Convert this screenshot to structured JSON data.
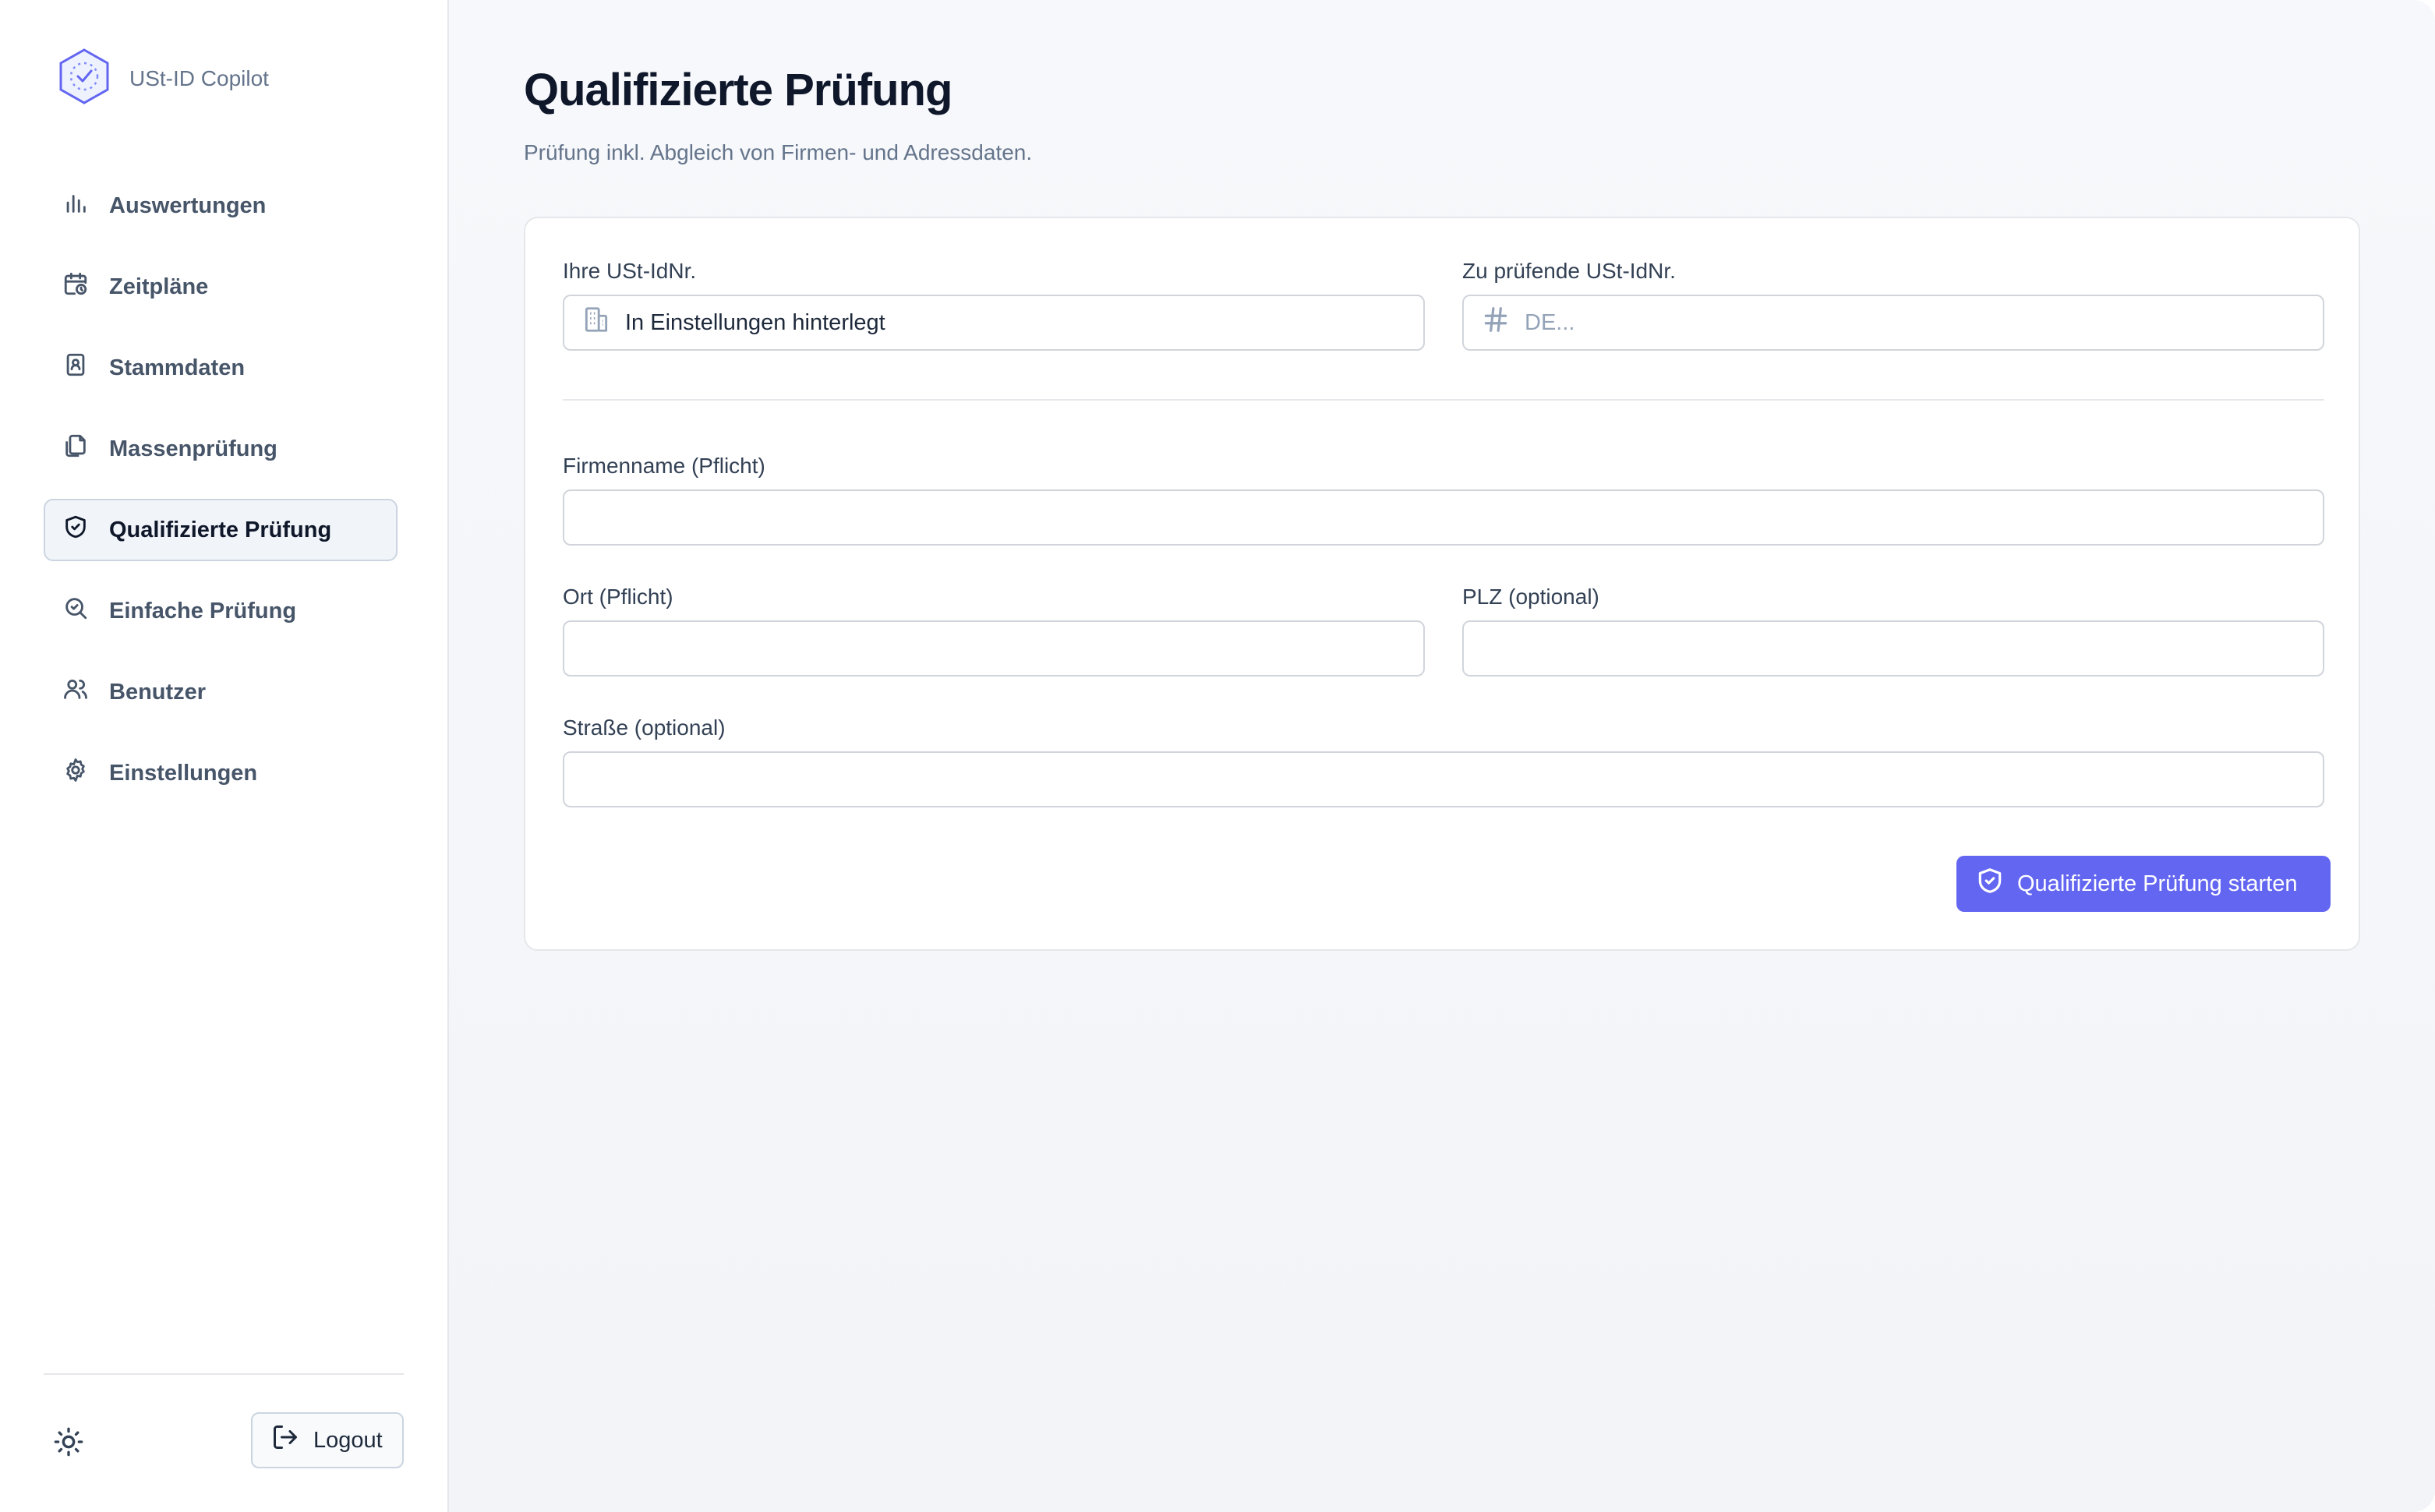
{
  "brand": {
    "name": "USt-ID Copilot",
    "icon": "hexagon-check-logo"
  },
  "nav": {
    "items": [
      {
        "label": "Auswertungen",
        "icon": "bar-chart-icon",
        "active": false
      },
      {
        "label": "Zeitpläne",
        "icon": "calendar-clock-icon",
        "active": false
      },
      {
        "label": "Stammdaten",
        "icon": "contact-book-icon",
        "active": false
      },
      {
        "label": "Massenprüfung",
        "icon": "files-icon",
        "active": false
      },
      {
        "label": "Qualifizierte Prüfung",
        "icon": "shield-check-icon",
        "active": true
      },
      {
        "label": "Einfache Prüfung",
        "icon": "search-check-icon",
        "active": false
      },
      {
        "label": "Benutzer",
        "icon": "users-icon",
        "active": false
      },
      {
        "label": "Einstellungen",
        "icon": "gear-icon",
        "active": false
      }
    ]
  },
  "footer": {
    "logout_label": "Logout",
    "theme_icon": "sun-icon"
  },
  "page": {
    "title": "Qualifizierte Prüfung",
    "subtitle": "Prüfung inkl. Abgleich von Firmen- und Adressdaten."
  },
  "form": {
    "own_vat": {
      "label": "Ihre USt-IdNr.",
      "value": "In Einstellungen hinterlegt",
      "icon": "building-icon"
    },
    "target_vat": {
      "label": "Zu prüfende USt-IdNr.",
      "value": "",
      "placeholder": "DE...",
      "icon": "hash-icon"
    },
    "company": {
      "label": "Firmenname (Pflicht)",
      "value": ""
    },
    "city": {
      "label": "Ort (Pflicht)",
      "value": ""
    },
    "zip": {
      "label": "PLZ (optional)",
      "value": ""
    },
    "street": {
      "label": "Straße (optional)",
      "value": ""
    },
    "submit_label": "Qualifizierte Prüfung starten",
    "submit_icon": "shield-check-icon"
  },
  "colors": {
    "accent": "#6366f1",
    "sidebar_active_bg": "#f1f5f9",
    "text_primary": "#0f172a",
    "text_muted": "#64748b"
  }
}
